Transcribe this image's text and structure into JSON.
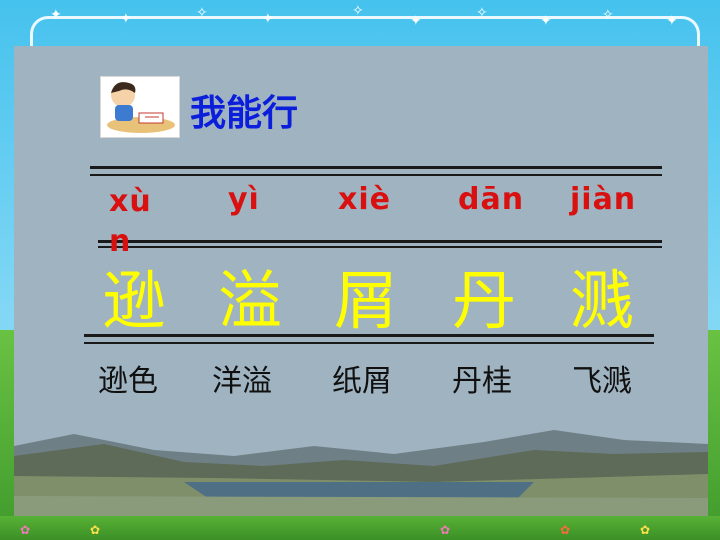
{
  "heading": "我能行",
  "items": [
    {
      "pinyin": "xùn",
      "character": "逊",
      "word": "逊色"
    },
    {
      "pinyin": "yì",
      "character": "溢",
      "word": "洋溢"
    },
    {
      "pinyin": "xiè",
      "character": "屑",
      "word": "纸屑"
    },
    {
      "pinyin": "dān",
      "character": "丹",
      "word": "丹桂"
    },
    {
      "pinyin": "jiàn",
      "character": "溅",
      "word": "飞溅"
    }
  ],
  "icons": {
    "avatar": "boy-reading-icon",
    "sparkle": "sparkle-icon",
    "flower": "flower-icon"
  },
  "colors": {
    "heading": "#0a1edc",
    "pinyin": "#d91010",
    "character": "#ffff00",
    "word": "#101010",
    "panel": "#9fb3c0",
    "sky": "#45c2ee"
  }
}
